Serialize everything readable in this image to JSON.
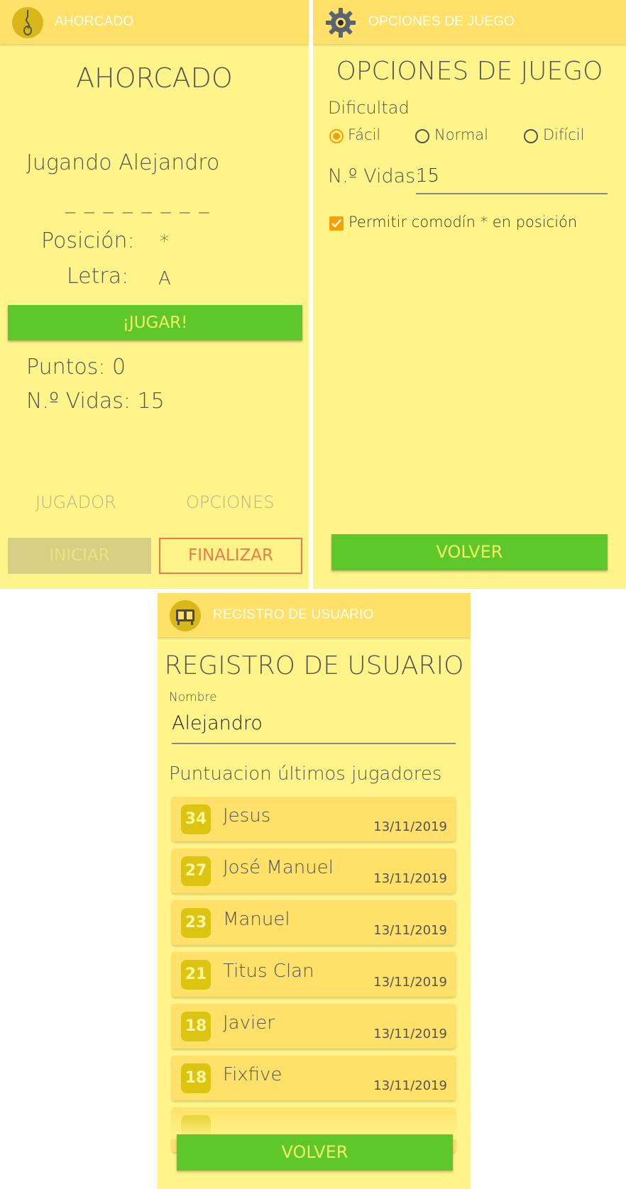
{
  "screen1": {
    "appbar_title": "AHORCADO",
    "heading": "AHORCADO",
    "playing_label": "Jugando Alejandro",
    "word_mask": "_ _ _ _ _ _ _ _",
    "position_label": "Posición:",
    "position_value": "*",
    "letter_label": "Letra:",
    "letter_value": "A",
    "play_button": "¡JUGAR!",
    "points_label": "Puntos: 0",
    "lives_label": "N.º Vidas: 15",
    "tab_player": "JUGADOR",
    "tab_options": "OPCIONES",
    "start_button": "INICIAR",
    "finish_button": "FINALIZAR",
    "logo_icon": "hangman-noose-icon"
  },
  "screen2": {
    "appbar_title": "OPCIONES DE JUEGO",
    "heading": "OPCIONES DE JUEGO",
    "difficulty_label": "Dificultad",
    "difficulty_options": [
      "Fácil",
      "Normal",
      "Difícil"
    ],
    "difficulty_selected": "Fácil",
    "lives_label": "N.º Vidas:",
    "lives_value": "15",
    "wildcard_label": "Permitir comodín * en posición",
    "wildcard_checked": true,
    "back_button": "VOLVER",
    "logo_icon": "gear-icon"
  },
  "screen3": {
    "appbar_title": "REGISTRO DE USUARIO",
    "heading": "REGISTRO DE USUARIO",
    "name_hint": "Nombre",
    "name_value": "Alejandro",
    "scores_label": "Puntuacion últimos jugadores",
    "scores": [
      {
        "points": "34",
        "name": "Jesus",
        "date": "13/11/2019"
      },
      {
        "points": "27",
        "name": "José Manuel",
        "date": "13/11/2019"
      },
      {
        "points": "23",
        "name": "Manuel",
        "date": "13/11/2019"
      },
      {
        "points": "21",
        "name": "Titus Clan",
        "date": "13/11/2019"
      },
      {
        "points": "18",
        "name": "Javier",
        "date": "13/11/2019"
      },
      {
        "points": "18",
        "name": "Fixfive",
        "date": "13/11/2019"
      }
    ],
    "back_button": "VOLVER",
    "logo_icon": "scoreboard-icon"
  },
  "colors": {
    "background": "#fff489",
    "appbar": "#ffe068",
    "green_button": "#5ec72b",
    "accent_orange": "#f5a100",
    "badge": "#dcc410"
  }
}
